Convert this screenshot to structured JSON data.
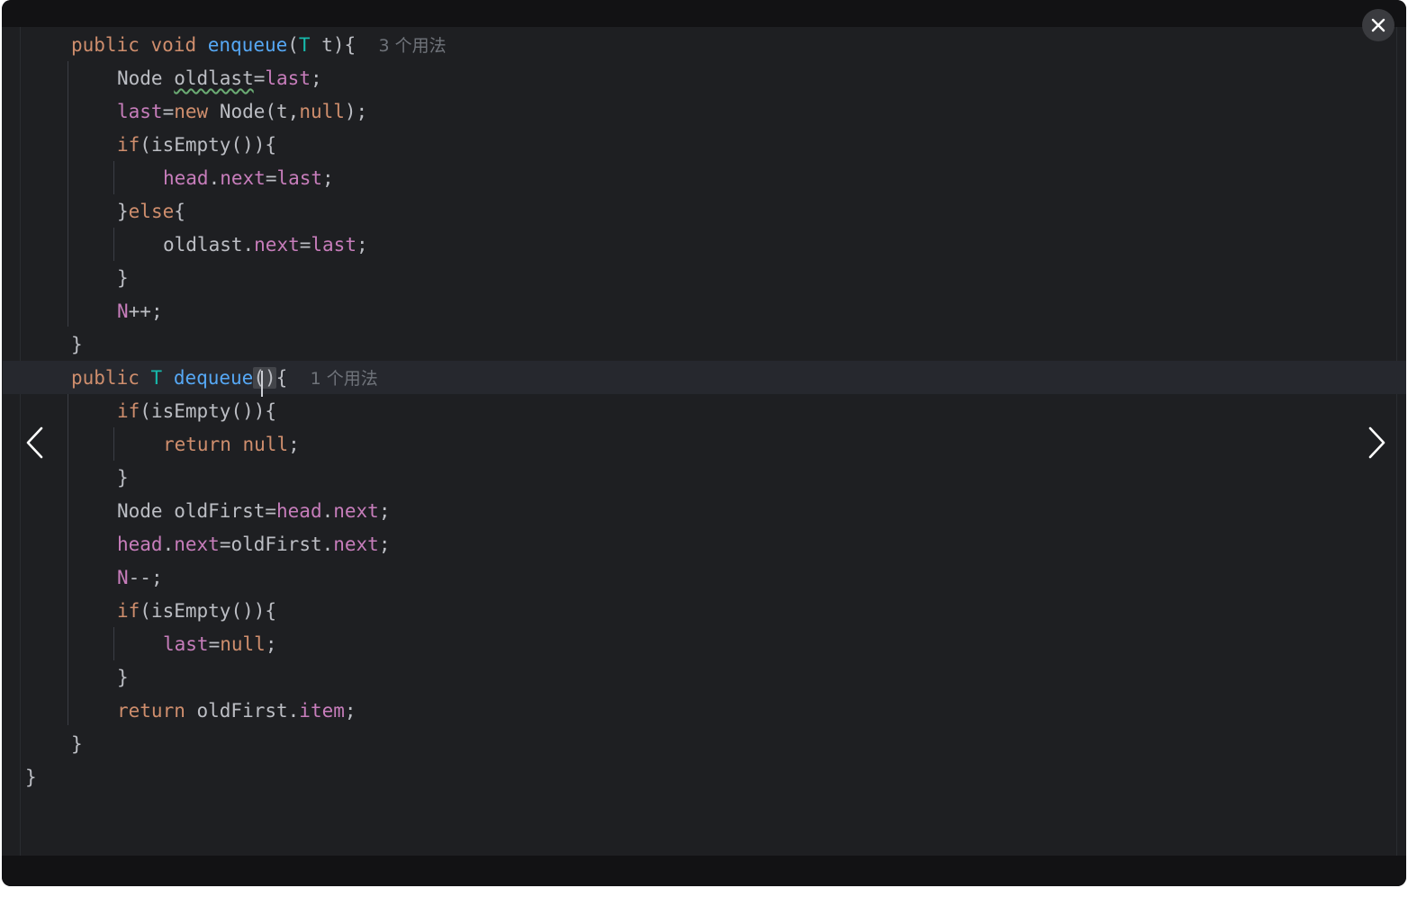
{
  "controls": {
    "close_icon": "close-icon",
    "prev_icon": "chevron-left-icon",
    "next_icon": "chevron-right-icon"
  },
  "code": {
    "l1": {
      "kw1": "public",
      "kw2": "void",
      "fn": "enqueue",
      "p1": "(",
      "ty": "T",
      "p2": " t){",
      "hint": "3 个用法"
    },
    "l2": {
      "a": "Node ",
      "b": "oldlast",
      "c": "=",
      "d": "last",
      "e": ";"
    },
    "l3": {
      "a": "last",
      "b": "=",
      "c": "new",
      "d": " Node(t,",
      "e": "null",
      "f": ");"
    },
    "l4": {
      "a": "if",
      "b": "(isEmpty()){"
    },
    "l5": {
      "a": "head",
      "b": ".",
      "c": "next",
      "d": "=",
      "e": "last",
      "f": ";"
    },
    "l6": {
      "a": "}",
      "b": "else",
      "c": "{"
    },
    "l7": {
      "a": "oldlast.",
      "b": "next",
      "c": "=",
      "d": "last",
      "e": ";"
    },
    "l8": {
      "a": "}"
    },
    "l9": {
      "a": "N",
      "b": "++;"
    },
    "l10": {
      "a": "}"
    },
    "l11": {
      "kw1": "public",
      "ty": "T",
      "fn": "dequeue",
      "paren": "()",
      "p2": "{",
      "hint": "1 个用法"
    },
    "l12": {
      "a": "if",
      "b": "(isEmpty()){"
    },
    "l13": {
      "a": "return",
      "b": "null",
      "c": ";"
    },
    "l14": {
      "a": "}"
    },
    "l15": {
      "a": "Node oldFirst=",
      "b": "head",
      "c": ".",
      "d": "next",
      "e": ";"
    },
    "l16": {
      "a": "head",
      "b": ".",
      "c": "next",
      "d": "=oldFirst.",
      "e": "next",
      "f": ";"
    },
    "l17": {
      "a": "N",
      "b": "--;"
    },
    "l18": {
      "a": "if",
      "b": "(isEmpty()){"
    },
    "l19": {
      "a": "last",
      "b": "=",
      "c": "null",
      "d": ";"
    },
    "l20": {
      "a": "}"
    },
    "l21": {
      "a": "return",
      "b": " oldFirst.",
      "c": "item",
      "d": ";"
    },
    "l22": {
      "a": "}"
    },
    "l23": {
      "a": "}"
    }
  },
  "colors": {
    "background": "#1e1f22",
    "keyword": "#cf8e6d",
    "function": "#56a8f5",
    "type_param": "#16baac",
    "field": "#c77dbb",
    "text": "#bcbec4",
    "hint": "#6f737a"
  }
}
